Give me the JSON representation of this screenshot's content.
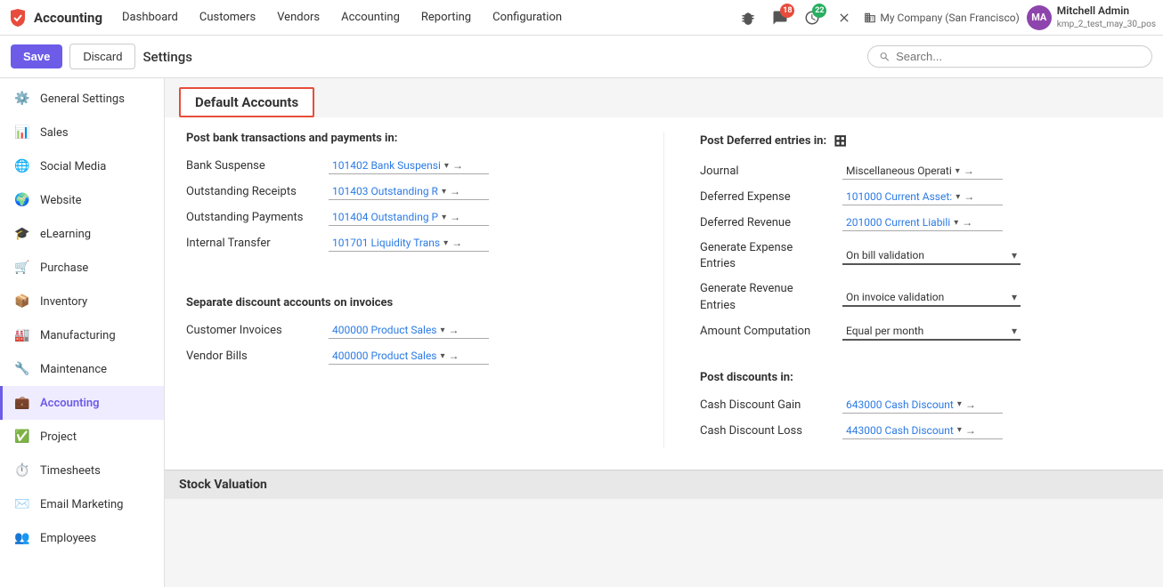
{
  "app": {
    "logo_text": "Accounting",
    "nav_items": [
      "Dashboard",
      "Customers",
      "Vendors",
      "Accounting",
      "Reporting",
      "Configuration"
    ],
    "notification_bug_count": "",
    "notification_chat_count": "18",
    "notification_clock_count": "22",
    "company": "My Company (San Francisco)",
    "user_name": "Mitchell Admin",
    "user_sub": "kmp_2_test_may_30_pos",
    "avatar_initials": "MA"
  },
  "toolbar": {
    "save_label": "Save",
    "discard_label": "Discard",
    "settings_label": "Settings",
    "search_placeholder": "Search..."
  },
  "sidebar": {
    "items": [
      {
        "id": "general-settings",
        "label": "General Settings",
        "icon": "⚙️"
      },
      {
        "id": "sales",
        "label": "Sales",
        "icon": "📊"
      },
      {
        "id": "social-media",
        "label": "Social Media",
        "icon": "🌐"
      },
      {
        "id": "website",
        "label": "Website",
        "icon": "🌍"
      },
      {
        "id": "elearning",
        "label": "eLearning",
        "icon": "🎓"
      },
      {
        "id": "purchase",
        "label": "Purchase",
        "icon": "🛒"
      },
      {
        "id": "inventory",
        "label": "Inventory",
        "icon": "📦"
      },
      {
        "id": "manufacturing",
        "label": "Manufacturing",
        "icon": "🏭"
      },
      {
        "id": "maintenance",
        "label": "Maintenance",
        "icon": "🔧"
      },
      {
        "id": "accounting",
        "label": "Accounting",
        "icon": "💼"
      },
      {
        "id": "project",
        "label": "Project",
        "icon": "✅"
      },
      {
        "id": "timesheets",
        "label": "Timesheets",
        "icon": "⏱️"
      },
      {
        "id": "email-marketing",
        "label": "Email Marketing",
        "icon": "✉️"
      },
      {
        "id": "employees",
        "label": "Employees",
        "icon": "👥"
      }
    ]
  },
  "main": {
    "section_title": "Default Accounts",
    "left_section": {
      "title": "Post bank transactions and payments in:",
      "fields": [
        {
          "label": "Bank Suspense",
          "value": "101402 Bank Suspensi▾",
          "has_arrow": true
        },
        {
          "label": "Outstanding Receipts",
          "value": "101403 Outstanding R▾",
          "has_arrow": true
        },
        {
          "label": "Outstanding Payments",
          "value": "101404 Outstanding P▾",
          "has_arrow": true
        },
        {
          "label": "Internal Transfer",
          "value": "101701 Liquidity Trans▾",
          "has_arrow": true
        }
      ]
    },
    "right_section": {
      "title": "Post Deferred entries in:",
      "fields": [
        {
          "label": "Journal",
          "value": "Miscellaneous Operati▾",
          "has_arrow": true,
          "is_link": false
        },
        {
          "label": "Deferred Expense",
          "value": "101000 Current Asset:▾",
          "has_arrow": true,
          "is_link": true
        },
        {
          "label": "Deferred Revenue",
          "value": "201000 Current Liabili▾",
          "has_arrow": true,
          "is_link": true
        },
        {
          "label": "Generate Expense\nEntries",
          "value": "On bill validation",
          "has_arrow": false,
          "is_select": true
        },
        {
          "label": "Generate Revenue\nEntries",
          "value": "On invoice validation",
          "has_arrow": false,
          "is_select": true
        },
        {
          "label": "Amount Computation",
          "value": "Equal per month",
          "has_arrow": false,
          "is_select": true
        }
      ]
    },
    "discount_section": {
      "title": "Separate discount accounts on invoices",
      "fields": [
        {
          "label": "Customer Invoices",
          "value": "400000 Product Sales ▾",
          "has_arrow": true
        },
        {
          "label": "Vendor Bills",
          "value": "400000 Product Sales ▾",
          "has_arrow": true
        }
      ]
    },
    "post_discounts_section": {
      "title": "Post discounts in:",
      "fields": [
        {
          "label": "Cash Discount Gain",
          "value": "643000 Cash Discount▾",
          "has_arrow": true
        },
        {
          "label": "Cash Discount Loss",
          "value": "443000 Cash Discount▾",
          "has_arrow": true
        }
      ]
    },
    "stock_valuation_title": "Stock Valuation"
  }
}
